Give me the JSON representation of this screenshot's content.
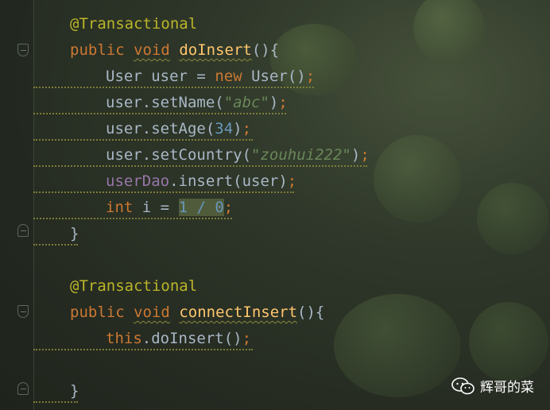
{
  "code": {
    "annotation": "@Transactional",
    "lines": [
      {
        "tokens": [
          {
            "t": "@Transactional",
            "c": "ann"
          }
        ]
      },
      {
        "tokens": [
          {
            "t": "public",
            "c": "kw"
          },
          {
            "t": " ",
            "c": "plain"
          },
          {
            "t": "void",
            "c": "kw wavy"
          },
          {
            "t": " ",
            "c": "plain"
          },
          {
            "t": "doInsert",
            "c": "fn wavy"
          },
          {
            "t": "(){",
            "c": "plain"
          }
        ]
      },
      {
        "tokens": [
          {
            "t": "User",
            "c": "plain"
          },
          {
            "t": " user ",
            "c": "plain"
          },
          {
            "t": "=",
            "c": "plain"
          },
          {
            "t": " ",
            "c": "plain"
          },
          {
            "t": "new",
            "c": "kw"
          },
          {
            "t": " User()",
            "c": "plain"
          },
          {
            "t": ";",
            "c": "kw"
          }
        ]
      },
      {
        "tokens": [
          {
            "t": "user.setName(",
            "c": "plain"
          },
          {
            "t": "\"abc\"",
            "c": "str"
          },
          {
            "t": ")",
            "c": "plain"
          },
          {
            "t": ";",
            "c": "kw"
          }
        ]
      },
      {
        "tokens": [
          {
            "t": "user.setAge(",
            "c": "plain"
          },
          {
            "t": "34",
            "c": "num"
          },
          {
            "t": ")",
            "c": "plain"
          },
          {
            "t": ";",
            "c": "kw"
          }
        ]
      },
      {
        "tokens": [
          {
            "t": "user.setCountry(",
            "c": "plain"
          },
          {
            "t": "\"zouhui222\"",
            "c": "str"
          },
          {
            "t": ")",
            "c": "plain"
          },
          {
            "t": ";",
            "c": "kw"
          }
        ]
      },
      {
        "tokens": [
          {
            "t": "userDao",
            "c": "field"
          },
          {
            "t": ".insert(user)",
            "c": "plain"
          },
          {
            "t": ";",
            "c": "kw"
          }
        ]
      },
      {
        "tokens": [
          {
            "t": "int",
            "c": "kw"
          },
          {
            "t": " i ",
            "c": "plain"
          },
          {
            "t": "=",
            "c": "plain"
          },
          {
            "t": " ",
            "c": "plain"
          },
          {
            "t": "1 / 0",
            "c": "num sel"
          },
          {
            "t": ";",
            "c": "kw"
          }
        ]
      },
      {
        "tokens": [
          {
            "t": "}",
            "c": "plain"
          }
        ]
      },
      {
        "tokens": []
      },
      {
        "tokens": [
          {
            "t": "@Transactional",
            "c": "ann"
          }
        ]
      },
      {
        "tokens": [
          {
            "t": "public",
            "c": "kw"
          },
          {
            "t": " ",
            "c": "plain"
          },
          {
            "t": "void",
            "c": "kw wavy"
          },
          {
            "t": " ",
            "c": "plain"
          },
          {
            "t": "connectInsert",
            "c": "fn wavy"
          },
          {
            "t": "(){",
            "c": "plain"
          }
        ]
      },
      {
        "tokens": [
          {
            "t": "this",
            "c": "kw"
          },
          {
            "t": ".doInsert()",
            "c": "plain"
          },
          {
            "t": ";",
            "c": "kw"
          }
        ]
      },
      {
        "tokens": []
      },
      {
        "tokens": [
          {
            "t": "}",
            "c": "plain"
          }
        ]
      }
    ]
  },
  "watermark": {
    "text": "辉哥的菜",
    "icon": "wechat-icon"
  },
  "colors": {
    "keyword": "#cc7832",
    "annotation": "#bbb529",
    "method": "#ffc66d",
    "string": "#6a8759",
    "number": "#6897bb",
    "field": "#9876aa",
    "text": "#a9b7c6"
  }
}
